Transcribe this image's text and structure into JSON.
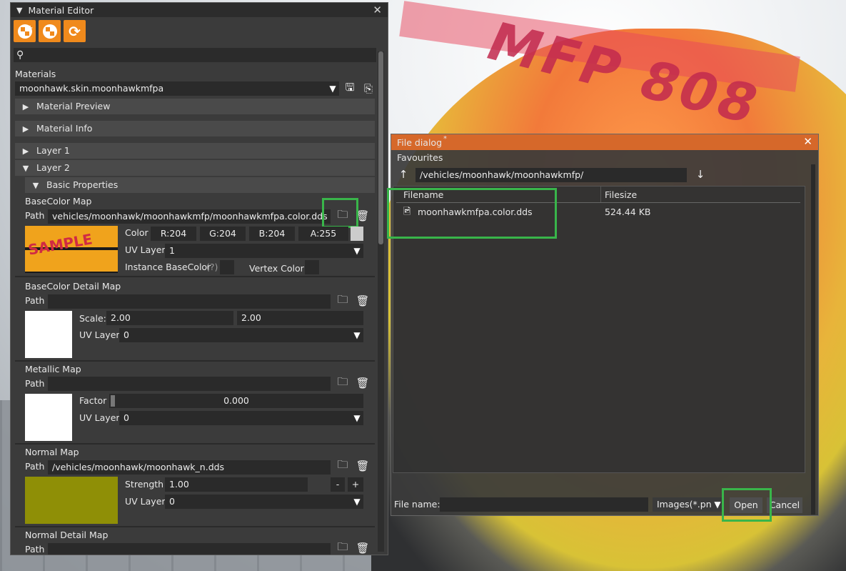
{
  "material_editor": {
    "title": "Material Editor",
    "materials_label": "Materials",
    "selected_material": "moonhawk.skin.moonhawkmfpa",
    "sections": {
      "material_preview": "Material Preview",
      "material_info": "Material Info",
      "layer1": "Layer 1",
      "layer2": "Layer 2",
      "basic_properties": "Basic Properties"
    },
    "basecolor_map": {
      "title": "BaseColor Map",
      "path_label": "Path",
      "path_value": "vehicles/moonhawk/moonhawkmfp/moonhawkmfpa.color.dds",
      "color_label": "Color",
      "r": "R:204",
      "g": "G:204",
      "b": "B:204",
      "a": "A:255",
      "uv_label": "UV Layer",
      "uv_value": "1",
      "instance_label": "Instance BaseColor",
      "help": "(?)",
      "vertex_label": "Vertex Color"
    },
    "basecolor_detail_map": {
      "title": "BaseColor Detail Map",
      "path_label": "Path",
      "scale_label": "Scale:",
      "scale_x": "2.00",
      "scale_y": "2.00",
      "uv_label": "UV Layer",
      "uv_value": "0"
    },
    "metallic_map": {
      "title": "Metallic Map",
      "path_label": "Path",
      "factor_label": "Factor",
      "factor_value": "0.000",
      "uv_label": "UV Layer",
      "uv_value": "0"
    },
    "normal_map": {
      "title": "Normal Map",
      "path_label": "Path",
      "path_value": "/vehicles/moonhawk/moonhawk_n.dds",
      "strength_label": "Strength",
      "strength_value": "1.00",
      "minus": "-",
      "plus": "+",
      "uv_label": "UV Layer",
      "uv_value": "0"
    },
    "normal_detail_map": {
      "title": "Normal Detail Map",
      "path_label": "Path"
    }
  },
  "file_dialog": {
    "title": "File dialog",
    "title_marker": "*",
    "favourites_label": "Favourites",
    "current_path": "/vehicles/moonhawk/moonhawkmfp/",
    "columns": [
      "Filename",
      "Filesize"
    ],
    "files": [
      {
        "name": "moonhawkmfpa.color.dds",
        "size": "524.44 KB"
      }
    ],
    "file_name_label": "File name:",
    "file_name_value": "",
    "filter_value": "Images(*.png,",
    "open_label": "Open",
    "cancel_label": "Cancel"
  },
  "background": {
    "car_text": "MFP 808"
  },
  "colors": {
    "accent_orange": "#f08a1c",
    "dialog_title": "#d6682a",
    "highlight_green": "#39b54a",
    "panel_bg": "#3b3b3b"
  }
}
